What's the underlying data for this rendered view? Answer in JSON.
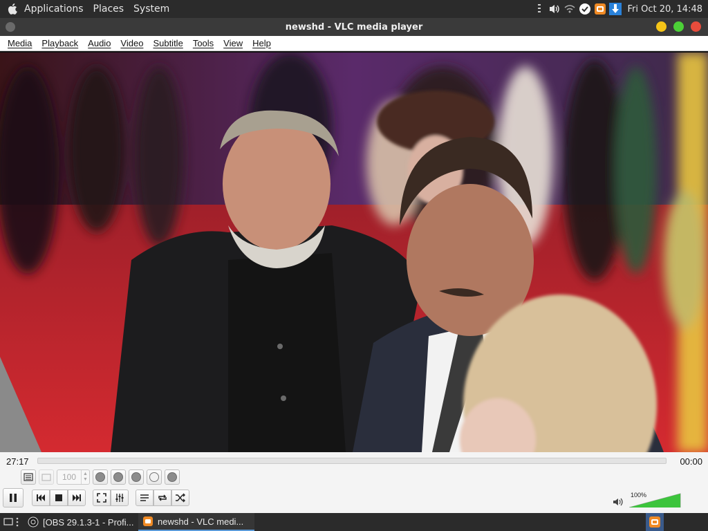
{
  "top_panel": {
    "menus": [
      "Applications",
      "Places",
      "System"
    ],
    "clock": "Fri Oct 20, 14:48"
  },
  "window": {
    "title": "newshd - VLC media player"
  },
  "menubar": {
    "items": [
      "Media",
      "Playback",
      "Audio",
      "Video",
      "Subtitle",
      "Tools",
      "View",
      "Help"
    ]
  },
  "player": {
    "elapsed": "27:17",
    "remaining": "00:00",
    "progress": 0.0,
    "speed_value": "100",
    "volume_label": "100%",
    "volume": 1.0
  },
  "taskbar": {
    "tasks": [
      {
        "label": "[OBS 29.1.3-1 - Profi..."
      },
      {
        "label": "newshd - VLC medi..."
      }
    ]
  },
  "colors": {
    "panel_bg": "#2b2b2b",
    "close": "#e74c3c",
    "maximize": "#4cd137",
    "minimize": "#f5c518",
    "accent": "#2a82da",
    "volume_green": "#3cc43c"
  }
}
